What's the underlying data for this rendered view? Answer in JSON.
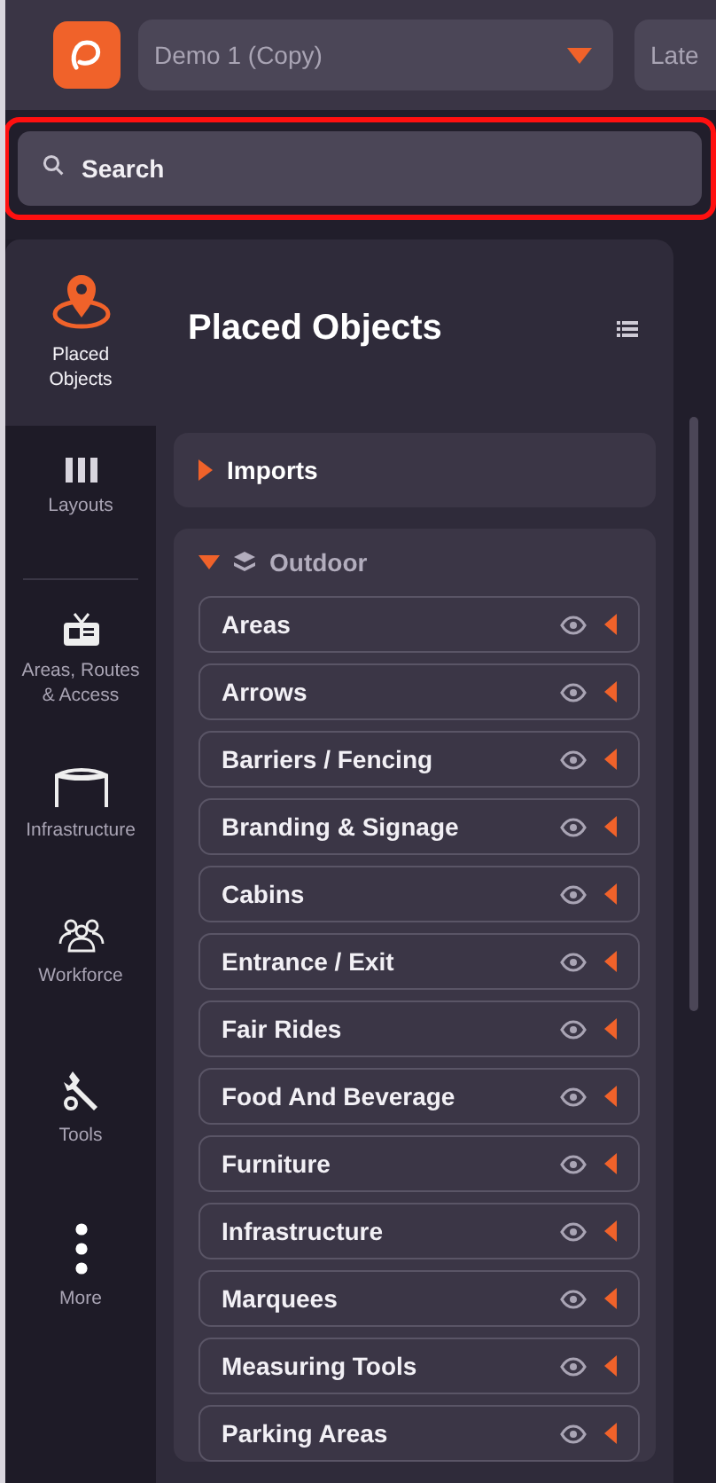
{
  "header": {
    "project": "Demo 1 (Copy)",
    "version_button": "Late"
  },
  "search": {
    "placeholder": "Search",
    "highlighted": true
  },
  "nav": [
    {
      "kind": "pin",
      "label": "Placed Objects",
      "selected": true
    },
    {
      "kind": "columns",
      "label": "Layouts",
      "selected": false
    },
    {
      "kind": "sign",
      "label": "Areas, Routes & Access",
      "selected": false
    },
    {
      "kind": "tent",
      "label": "Infrastructure",
      "selected": false
    },
    {
      "kind": "people",
      "label": "Workforce",
      "selected": false
    },
    {
      "kind": "tools",
      "label": "Tools",
      "selected": false
    },
    {
      "kind": "dots",
      "label": "More",
      "selected": false
    }
  ],
  "panel": {
    "title": "Placed Objects",
    "sections": [
      {
        "label": "Imports",
        "expanded": false
      },
      {
        "label": "Outdoor",
        "expanded": true,
        "items": [
          {
            "label": "Areas"
          },
          {
            "label": "Arrows"
          },
          {
            "label": "Barriers / Fencing"
          },
          {
            "label": "Branding & Signage"
          },
          {
            "label": "Cabins"
          },
          {
            "label": "Entrance / Exit"
          },
          {
            "label": "Fair Rides"
          },
          {
            "label": "Food And Beverage"
          },
          {
            "label": "Furniture"
          },
          {
            "label": "Infrastructure"
          },
          {
            "label": "Marquees"
          },
          {
            "label": "Measuring Tools"
          },
          {
            "label": "Parking Areas"
          }
        ]
      }
    ]
  }
}
